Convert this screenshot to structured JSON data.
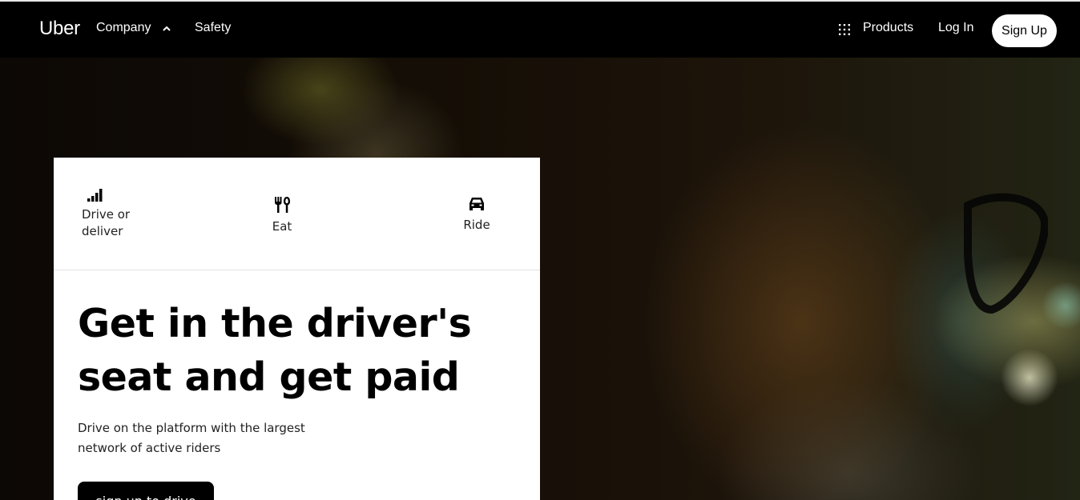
{
  "nav": {
    "brand": "Uber",
    "company": "Company",
    "safety": "Safety",
    "products": "Products",
    "login": "Log In",
    "signup": "Sign Up",
    "icons": {
      "company_toggle": "chevron-up-icon",
      "products": "grid-dots-icon"
    }
  },
  "tabs": [
    {
      "label": "Drive or deliver",
      "icon": "signal-bars-icon"
    },
    {
      "label": "Eat",
      "icon": "fork-knife-icon"
    },
    {
      "label": "Ride",
      "icon": "car-icon"
    }
  ],
  "hero": {
    "headline": "Get in the driver's seat and get paid",
    "subtext": "Drive on the platform with the largest network of active riders",
    "cta": "sign up to drive"
  },
  "colors": {
    "nav_bg": "#000000",
    "card_bg": "#ffffff",
    "text": "#000000",
    "button_bg": "#000000"
  }
}
